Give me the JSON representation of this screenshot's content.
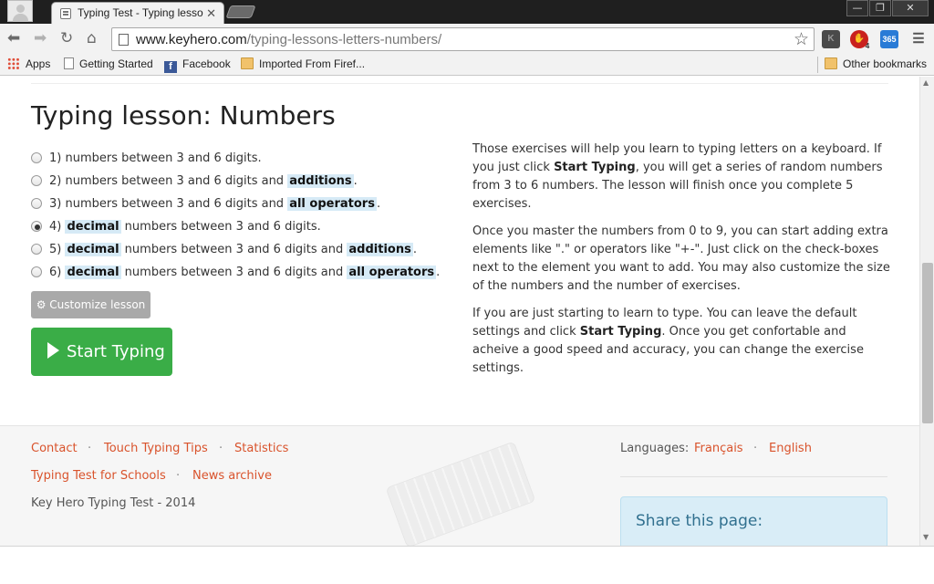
{
  "browser": {
    "tab_title": "Typing Test - Typing lesso",
    "tab_close": "✕",
    "window_controls": [
      "—",
      "❐",
      "✕"
    ],
    "url_domain": "www.keyhero.com",
    "url_path": "/typing-lessons-letters-numbers/",
    "extensions": [
      "K",
      "365"
    ],
    "ext_badge": "4"
  },
  "bookmarks": {
    "items": [
      "Apps",
      "Getting Started",
      "Facebook",
      "Imported From Firef..."
    ],
    "other": "Other bookmarks"
  },
  "lesson": {
    "title": "Typing lesson: Numbers",
    "options": [
      {
        "num": "1)",
        "pre": "numbers between 3 and 6 digits.",
        "selected": false
      },
      {
        "num": "2)",
        "pre": "numbers between 3 and 6 digits and ",
        "hl": "additions",
        "post": ".",
        "selected": false
      },
      {
        "num": "3)",
        "pre": "numbers between 3 and 6 digits and ",
        "hl": "all operators",
        "post": ".",
        "selected": false
      },
      {
        "num": "4)",
        "hl_first": "decimal",
        "rest": " numbers between 3 and 6 digits.",
        "selected": true
      },
      {
        "num": "5)",
        "hl_first": "decimal",
        "rest": " numbers between 3 and 6 digits and ",
        "hl": "additions",
        "post": ".",
        "selected": false
      },
      {
        "num": "6)",
        "hl_first": "decimal",
        "rest": " numbers between 3 and 6 digits and ",
        "hl": "all operators",
        "post": ".",
        "selected": false
      }
    ],
    "customize_label": "Customize lesson",
    "start_label": "Start Typing"
  },
  "description": {
    "p1_a": "Those exercises will help you learn to typing letters on a keyboard. If you just click ",
    "p1_b": "Start Typing",
    "p1_c": ", you will get a series of random numbers from 3 to 6 numbers. The lesson will finish once you complete 5 exercises.",
    "p2": "Once you master the numbers from 0 to 9, you can start adding extra elements like \".\" or operators like \"+-\". Just click on the check-boxes next to the element you want to add. You may also customize the size of the numbers and the number of exercises.",
    "p3_a": "If you are just starting to learn to type. You can leave the default settings and click ",
    "p3_b": "Start Typing",
    "p3_c": ". Once you get confortable and acheive a good speed and accuracy, you can change the exercise settings."
  },
  "footer": {
    "contact": "Contact",
    "tips": "Touch Typing Tips",
    "stats": "Statistics",
    "schools": "Typing Test for Schools",
    "news": "News archive",
    "copyright": "Key Hero Typing Test - 2014",
    "languages_label": "Languages:",
    "lang_fr": "Français",
    "lang_en": "English",
    "dot": "·",
    "share": "Share this page:"
  },
  "colors": {
    "accent_link": "#d9532c",
    "start_button": "#3aad47",
    "highlight": "#d6eaf6"
  }
}
